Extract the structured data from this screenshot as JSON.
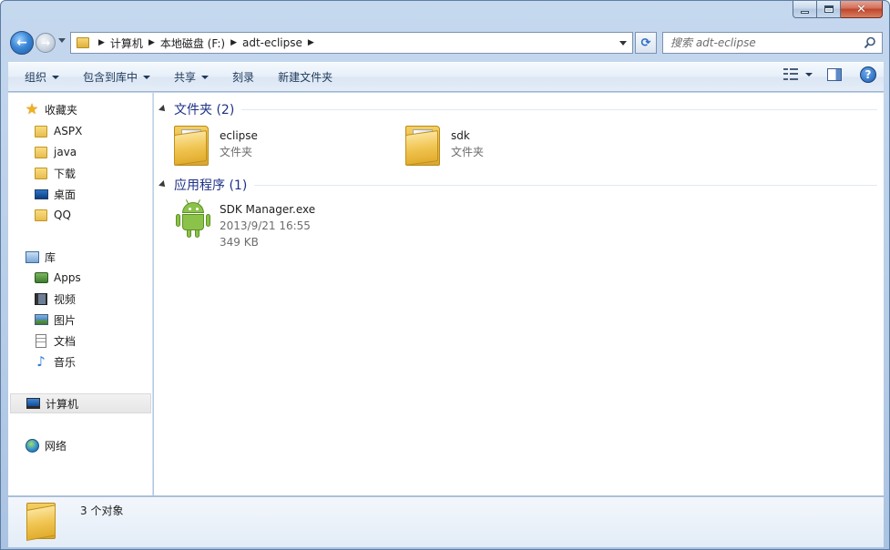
{
  "titlebar": {
    "minimize": "minimize",
    "maximize": "maximize",
    "close": "close"
  },
  "address": {
    "crumbs": [
      "计算机",
      "本地磁盘 (F:)",
      "adt-eclipse"
    ]
  },
  "search": {
    "placeholder": "搜索 adt-eclipse"
  },
  "toolbar": {
    "organize": "组织",
    "include_in_library": "包含到库中",
    "share": "共享",
    "burn": "刻录",
    "new_folder": "新建文件夹"
  },
  "sidebar": {
    "favorites": {
      "label": "收藏夹",
      "items": [
        {
          "label": "ASPX",
          "icon": "folder-icon"
        },
        {
          "label": "java",
          "icon": "folder-icon"
        },
        {
          "label": "下载",
          "icon": "folder-icon"
        },
        {
          "label": "桌面",
          "icon": "desktop-icon"
        },
        {
          "label": "QQ",
          "icon": "folder-icon"
        }
      ]
    },
    "libraries": {
      "label": "库",
      "items": [
        {
          "label": "Apps",
          "icon": "apps-icon"
        },
        {
          "label": "视频",
          "icon": "video-icon"
        },
        {
          "label": "图片",
          "icon": "picture-icon"
        },
        {
          "label": "文档",
          "icon": "document-icon"
        },
        {
          "label": "音乐",
          "icon": "music-icon"
        }
      ]
    },
    "computer": {
      "label": "计算机"
    },
    "network": {
      "label": "网络"
    }
  },
  "content": {
    "groups": [
      {
        "label": "文件夹 (2)",
        "items": [
          {
            "name": "eclipse",
            "type": "文件夹"
          },
          {
            "name": "sdk",
            "type": "文件夹"
          }
        ]
      },
      {
        "label": "应用程序 (1)",
        "items": [
          {
            "name": "SDK Manager.exe",
            "date": "2013/9/21 16:55",
            "size": "349 KB"
          }
        ]
      }
    ]
  },
  "status": {
    "text": "3 个对象"
  },
  "colors": {
    "group_header": "#1e3287",
    "toolbar_text": "#1e395b",
    "frame": "#b7cde7"
  }
}
